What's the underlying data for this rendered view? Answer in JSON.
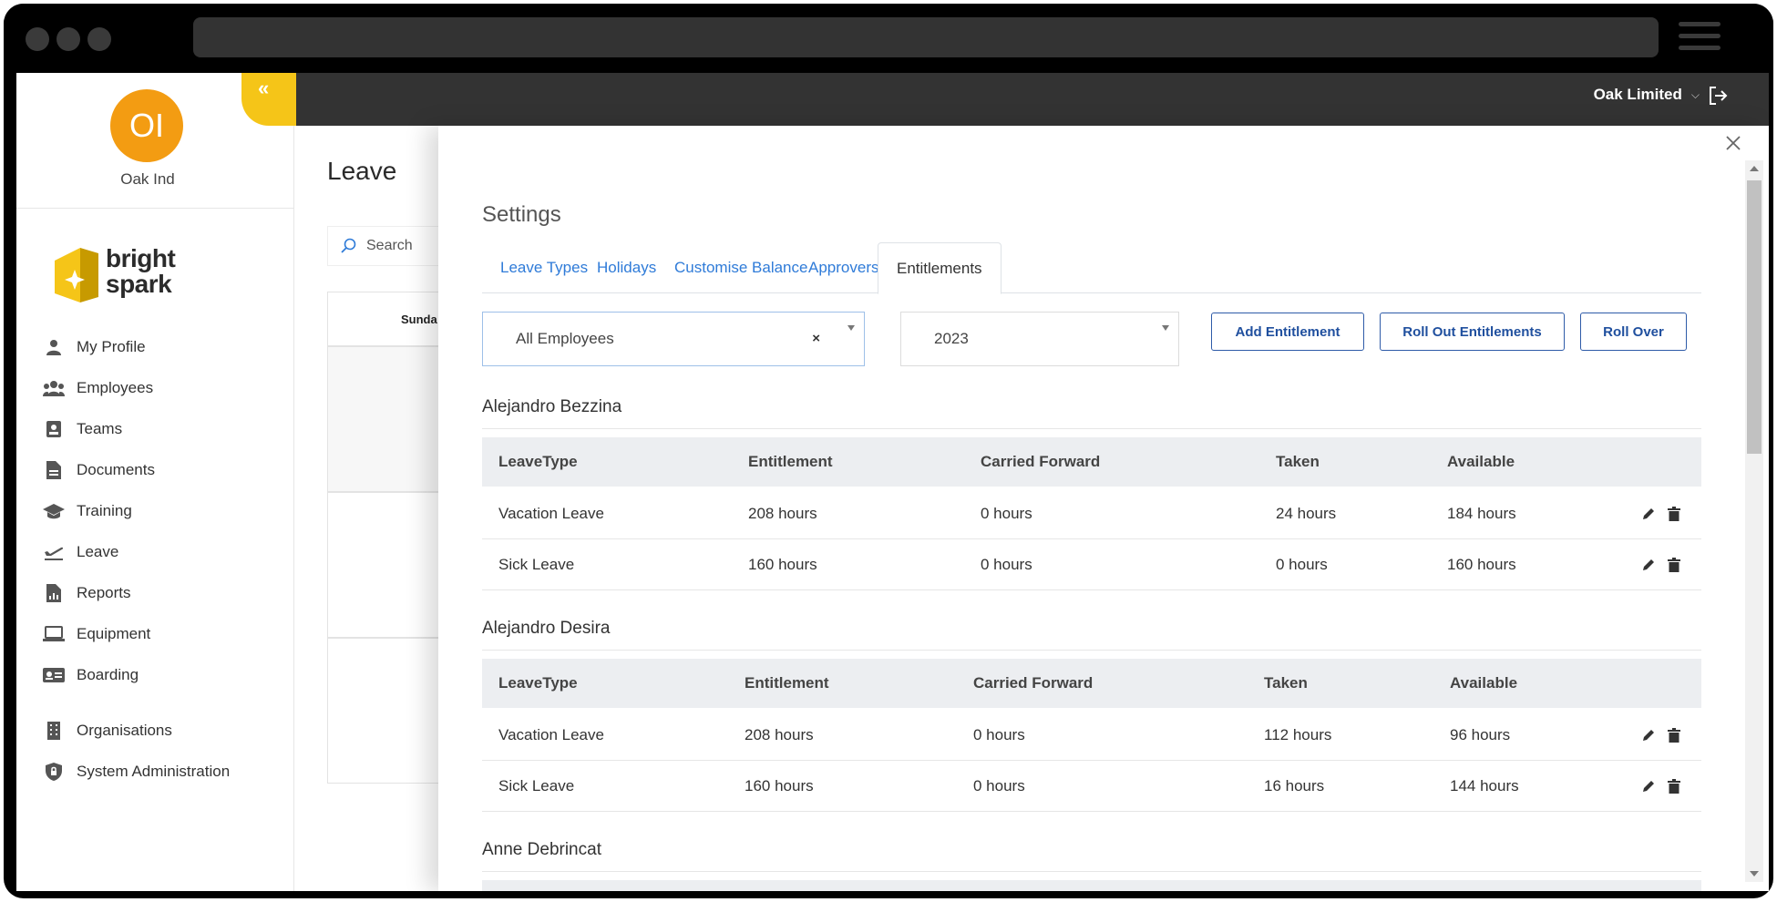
{
  "org": {
    "initials": "OI",
    "name": "Oak Ind"
  },
  "brand": {
    "logo_line1": "bright",
    "logo_line2": "spark"
  },
  "nav": [
    {
      "label": "My Profile",
      "icon": "user-icon"
    },
    {
      "label": "Employees",
      "icon": "employees-icon"
    },
    {
      "label": "Teams",
      "icon": "teams-icon"
    },
    {
      "label": "Documents",
      "icon": "document-icon"
    },
    {
      "label": "Training",
      "icon": "graduation-cap-icon"
    },
    {
      "label": "Leave",
      "icon": "plane-departure-icon"
    },
    {
      "label": "Reports",
      "icon": "report-icon"
    },
    {
      "label": "Equipment",
      "icon": "laptop-icon"
    },
    {
      "label": "Boarding",
      "icon": "id-card-icon"
    },
    {
      "label": "Organisations",
      "icon": "building-icon"
    },
    {
      "label": "System Administration",
      "icon": "shield-lock-icon"
    }
  ],
  "topbar": {
    "company": "Oak Limited",
    "collapse_glyph": "«"
  },
  "page": {
    "title": "Leave",
    "search_placeholder": "Search",
    "calendar_day": "Sunda"
  },
  "settings": {
    "title": "Settings",
    "tabs": [
      "Leave Types",
      "Holidays",
      "Customise Balance",
      "Approvers",
      "Entitlements"
    ],
    "active_tab": "Entitlements",
    "employee_filter": "All Employees",
    "clear_glyph": "×",
    "year": "2023",
    "buttons": {
      "add": "Add Entitlement",
      "roll_out": "Roll Out Entitlements",
      "roll_over": "Roll Over"
    },
    "columns": [
      "LeaveType",
      "Entitlement",
      "Carried Forward",
      "Taken",
      "Available"
    ],
    "employees": [
      {
        "name": "Alejandro Bezzina",
        "rows": [
          [
            "Vacation Leave",
            "208 hours",
            "0 hours",
            "24 hours",
            "184 hours"
          ],
          [
            "Sick Leave",
            "160 hours",
            "0 hours",
            "0 hours",
            "160 hours"
          ]
        ]
      },
      {
        "name": "Alejandro Desira",
        "rows": [
          [
            "Vacation Leave",
            "208 hours",
            "0 hours",
            "112 hours",
            "96 hours"
          ],
          [
            "Sick Leave",
            "160 hours",
            "0 hours",
            "16 hours",
            "144 hours"
          ]
        ]
      },
      {
        "name": "Anne Debrincat",
        "rows": []
      }
    ]
  },
  "colors": {
    "accent": "#f5c518",
    "avatar": "#f39c12",
    "topbar": "#333333",
    "link": "#2f7bd8",
    "button": "#1f4f9e"
  }
}
